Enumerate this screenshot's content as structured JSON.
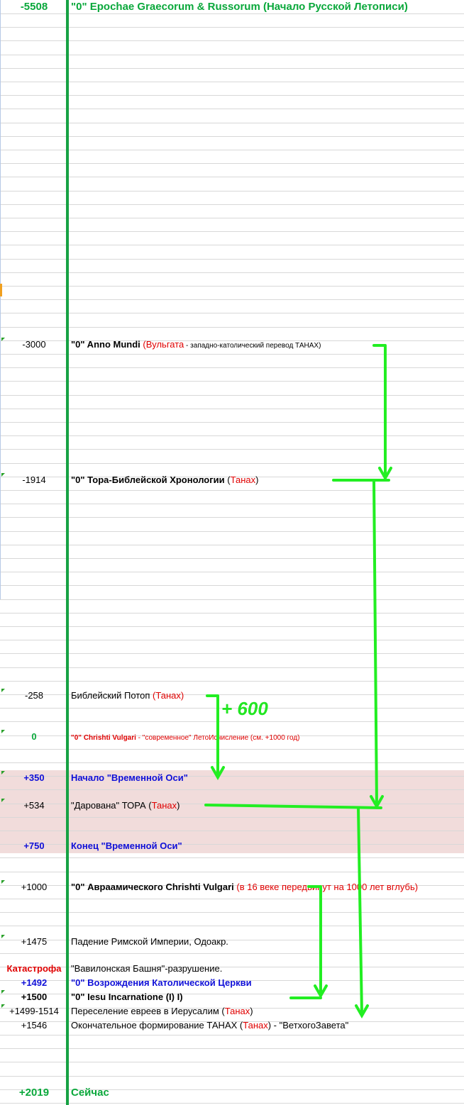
{
  "rows": [
    {
      "year": "-5508",
      "year_color": "green",
      "year_bold": true,
      "big": true,
      "parts": [
        {
          "t": "\"0\" Epochae Graecorum & Russorum (Начало Русской Летописи)",
          "c": "green",
          "b": true,
          "big": true
        }
      ]
    },
    {
      "year": "-3000",
      "parts": [
        {
          "t": "\"0\" Anno Mundi ",
          "b": true
        },
        {
          "t": "(",
          "c": "red"
        },
        {
          "t": "Вульгата",
          "c": "red"
        },
        {
          "t": " - западно-католический перевод ТАНАХ)",
          "small": true
        }
      ]
    },
    {
      "year": "-1914",
      "parts": [
        {
          "t": "\"0\" Тора-Библейской Хронологии ",
          "b": true
        },
        {
          "t": "(",
          "c": ""
        },
        {
          "t": "Танах",
          "c": "red"
        },
        {
          "t": ")"
        }
      ]
    },
    {
      "year": "-258",
      "parts": [
        {
          "t": "Библейский Потоп "
        },
        {
          "t": "(Танах)",
          "c": "red"
        }
      ]
    },
    {
      "year": "0",
      "year_color": "green",
      "year_bold": true,
      "parts": [
        {
          "t": "\"0\" Chrishti Vulgari",
          "c": "red",
          "b": true,
          "small": true
        },
        {
          "t": " - \"современное\" ЛетоИсчисление (см. +1000 год)",
          "c": "red",
          "small": true
        }
      ]
    },
    {
      "year": "+350",
      "year_color": "blue",
      "year_bold": true,
      "parts": [
        {
          "t": "Начало \"Временной Оси\"",
          "c": "blue",
          "b": true
        }
      ]
    },
    {
      "year": "+534",
      "parts": [
        {
          "t": "\"Дарована\" ТОРА ("
        },
        {
          "t": "Танах",
          "c": "red"
        },
        {
          "t": ")"
        }
      ]
    },
    {
      "year": "+750",
      "year_color": "blue",
      "year_bold": true,
      "parts": [
        {
          "t": "Конец \"Временной Оси\"",
          "c": "blue",
          "b": true
        }
      ]
    },
    {
      "year": "+1000",
      "parts": [
        {
          "t": "\"0\" Авраамического Chrishti Vulgari ",
          "b": true
        },
        {
          "t": "(в 16 веке передвинут на 1000 лет вглубь)",
          "c": "red"
        }
      ]
    },
    {
      "year": "+1475",
      "parts": [
        {
          "t": "Падение Римской Империи, Одоакр."
        }
      ]
    },
    {
      "year": "Катастрофа",
      "year_color": "red",
      "year_bold": true,
      "parts": [
        {
          "t": "\"Вавилонская Башня\"-разрушение."
        }
      ]
    },
    {
      "year": "+1492",
      "year_color": "blue",
      "year_bold": true,
      "parts": [
        {
          "t": "\"0\" Возрождения Католической Церкви",
          "c": "blue",
          "b": true
        }
      ]
    },
    {
      "year": "+1500",
      "year_bold": true,
      "parts": [
        {
          "t": "\"0\" Iesu Incarnatione (I) I)",
          "b": true
        }
      ]
    },
    {
      "year": "+1499-1514",
      "parts": [
        {
          "t": "Переселение евреев в Иерусалим ("
        },
        {
          "t": "Танах",
          "c": "red"
        },
        {
          "t": ")"
        }
      ]
    },
    {
      "year": "+1546",
      "parts": [
        {
          "t": "Окончательное формирование ТАНАХ ("
        },
        {
          "t": "Танах",
          "c": "red"
        },
        {
          "t": ") - \"ВетхогоЗавета\""
        }
      ]
    },
    {
      "year": "+2019",
      "year_color": "green",
      "year_bold": true,
      "big": true,
      "parts": [
        {
          "t": "Сейчас",
          "c": "green",
          "b": true,
          "big": true
        }
      ]
    }
  ],
  "annotation": {
    "label": "+ 600"
  },
  "colors": {
    "arrow": "#22ee22",
    "axis": "#17a244",
    "grid": "#d8d8d8",
    "band": "#f1dcdb"
  }
}
